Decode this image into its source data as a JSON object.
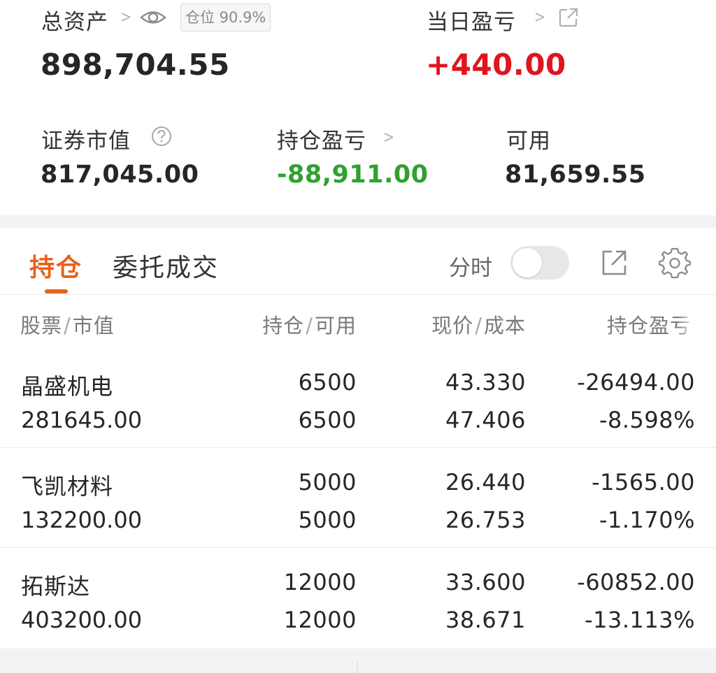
{
  "summary": {
    "total_assets_label": "总资产",
    "position_badge": "仓位 90.9%",
    "total_assets_value": "898,704.55",
    "daily_pnl_label": "当日盈亏",
    "daily_pnl_value": "+440.00",
    "market_value_label": "证券市值",
    "market_value_value": "817,045.00",
    "holding_pnl_label": "持仓盈亏",
    "holding_pnl_value": "-88,911.00",
    "available_label": "可用",
    "available_value": "81,659.55"
  },
  "tabs": [
    {
      "label": "持仓",
      "active": true
    },
    {
      "label": "委托成交",
      "active": false
    }
  ],
  "toolbar": {
    "timeshare_label": "分时",
    "timeshare_on": false
  },
  "table": {
    "headers": {
      "col1_a": "股票",
      "col1_b": "市值",
      "col2_a": "持仓",
      "col2_b": "可用",
      "col3_a": "现价",
      "col3_b": "成本",
      "col4": "持仓盈亏"
    },
    "rows": [
      {
        "name": "晶盛机电",
        "market_value": "281645.00",
        "holding": "6500",
        "available": "6500",
        "price": "43.330",
        "cost": "47.406",
        "pnl": "-26494.00",
        "pnl_pct": "-8.598%"
      },
      {
        "name": "飞凯材料",
        "market_value": "132200.00",
        "holding": "5000",
        "available": "5000",
        "price": "26.440",
        "cost": "26.753",
        "pnl": "-1565.00",
        "pnl_pct": "-1.170%"
      },
      {
        "name": "拓斯达",
        "market_value": "403200.00",
        "holding": "12000",
        "available": "12000",
        "price": "33.600",
        "cost": "38.671",
        "pnl": "-60852.00",
        "pnl_pct": "-13.113%"
      }
    ]
  },
  "colors": {
    "accent": "#e8621a",
    "profit": "#e0141e",
    "loss": "#2ea12e"
  },
  "icons": [
    "chevron-right-icon",
    "eye-icon",
    "external-link-icon",
    "help-circle-icon",
    "share-icon",
    "gear-icon"
  ]
}
